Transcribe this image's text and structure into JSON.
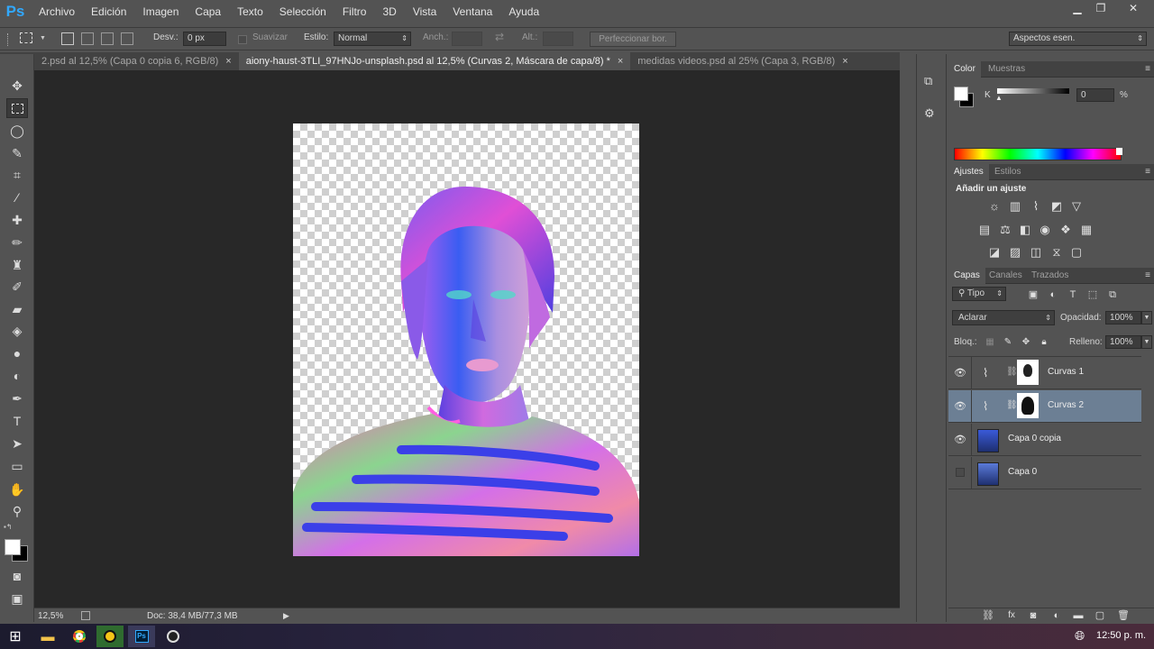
{
  "app": {
    "logo": "Ps"
  },
  "menu": [
    "Archivo",
    "Edición",
    "Imagen",
    "Capa",
    "Texto",
    "Selección",
    "Filtro",
    "3D",
    "Vista",
    "Ventana",
    "Ayuda"
  ],
  "window": {
    "minimize": "▁",
    "restore": "❐",
    "close": "✕"
  },
  "options": {
    "desv_label": "Desv.:",
    "desv_value": "0 px",
    "suavizar_label": "Suavizar",
    "estilo_label": "Estilo:",
    "estilo_value": "Normal",
    "anch_label": "Anch.:",
    "alt_label": "Alt.:",
    "perfeccionar": "Perfeccionar bor.",
    "workspace_preset": "Aspectos esen."
  },
  "tabs": [
    {
      "label": "2.psd al 12,5% (Capa 0 copia 6, RGB/8)",
      "close": "×"
    },
    {
      "label": "aiony-haust-3TLI_97HNJo-unsplash.psd al 12,5% (Curvas 2, Máscara de capa/8) *",
      "close": "×"
    },
    {
      "label": "medidas videos.psd al 25% (Capa 3, RGB/8)",
      "close": "×"
    }
  ],
  "status": {
    "zoom": "12,5%",
    "doc": "Doc: 38,4 MB/77,3 MB"
  },
  "color_panel": {
    "tabs": [
      "Color",
      "Muestras"
    ],
    "channel": "K",
    "value": "0",
    "unit": "%"
  },
  "adjust_panel": {
    "tabs": [
      "Ajustes",
      "Estilos"
    ],
    "heading": "Añadir un ajuste"
  },
  "layers_panel": {
    "tabs": [
      "Capas",
      "Canales",
      "Trazados"
    ],
    "filter": "Tipo",
    "blend_mode": "Aclarar",
    "opacity_label": "Opacidad:",
    "opacity_value": "100%",
    "lock_label": "Bloq.:",
    "fill_label": "Relleno:",
    "fill_value": "100%",
    "layers": [
      {
        "name": "Curvas 1",
        "visible": true,
        "selected": false
      },
      {
        "name": "Curvas 2",
        "visible": true,
        "selected": true
      },
      {
        "name": "Capa 0 copia",
        "visible": true,
        "selected": false
      },
      {
        "name": "Capa 0",
        "visible": false,
        "selected": false
      }
    ]
  },
  "taskbar": {
    "time": "12:50 p. m."
  },
  "colors": {
    "panel_bg": "#535353",
    "workspace_bg": "#282828",
    "selected_layer": "#6c7f94",
    "ps_blue": "#31a8ff"
  },
  "icons": [
    "windows-icon",
    "folder-icon",
    "chrome-icon",
    "app-icon",
    "photoshop-icon",
    "obs-icon",
    "language-icon"
  ]
}
